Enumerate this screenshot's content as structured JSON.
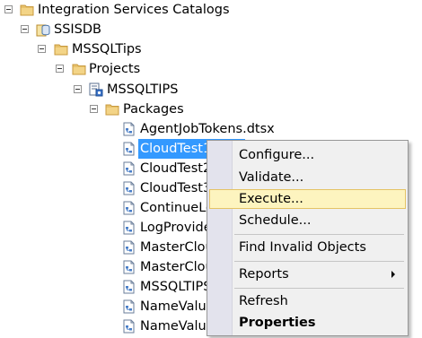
{
  "tree": {
    "catalogs_label": "Integration Services Catalogs",
    "ssisdb_label": "SSISDB",
    "folder_label": "MSSQLTips",
    "projects_label": "Projects",
    "project_label": "MSSQLTIPS",
    "packages_label": "Packages",
    "packages": [
      "AgentJobTokens.dtsx",
      "CloudTest1.dtsx",
      "CloudTest2",
      "CloudTest3",
      "ContinueLo",
      "LogProvide",
      "MasterClou",
      "MasterClou",
      "MSSQLTIPS",
      "NameValue",
      "NameValue"
    ],
    "selected_package_index": 1
  },
  "context_menu": {
    "items": [
      "Configure...",
      "Validate...",
      "Execute...",
      "Schedule...",
      "Find Invalid Objects",
      "Reports",
      "Refresh",
      "Properties"
    ],
    "highlighted_index": 2,
    "submenu_index": 5,
    "bold_index": 7
  },
  "colors": {
    "selection": "#3399ff",
    "menu_background": "#f0f0f0",
    "menu_highlight": "#fdf4bf",
    "folder": "#e8c26c"
  }
}
